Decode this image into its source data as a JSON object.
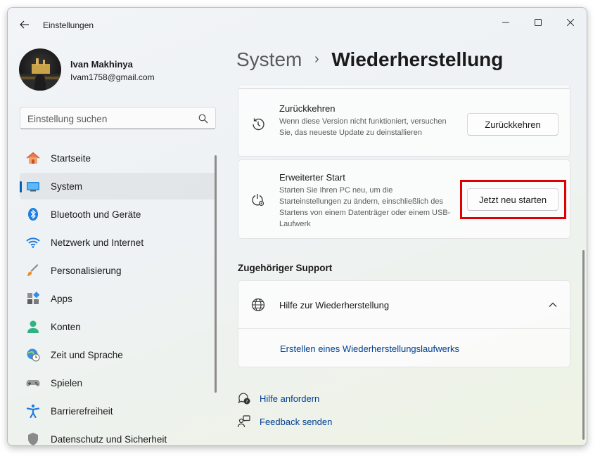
{
  "app": {
    "title": "Einstellungen"
  },
  "window_controls": {
    "minimize": "—",
    "maximize": "☐",
    "close": "✕"
  },
  "user": {
    "name": "Ivan Makhinya",
    "email": "Ivam1758@gmail.com"
  },
  "search": {
    "placeholder": "Einstellung suchen"
  },
  "sidebar": {
    "items": [
      {
        "label": "Startseite",
        "icon": "home-icon",
        "selected": false
      },
      {
        "label": "System",
        "icon": "system-icon",
        "selected": true
      },
      {
        "label": "Bluetooth und Geräte",
        "icon": "bluetooth-icon",
        "selected": false
      },
      {
        "label": "Netzwerk und Internet",
        "icon": "wifi-icon",
        "selected": false
      },
      {
        "label": "Personalisierung",
        "icon": "brush-icon",
        "selected": false
      },
      {
        "label": "Apps",
        "icon": "apps-icon",
        "selected": false
      },
      {
        "label": "Konten",
        "icon": "account-icon",
        "selected": false
      },
      {
        "label": "Zeit und Sprache",
        "icon": "globe-clock-icon",
        "selected": false
      },
      {
        "label": "Spielen",
        "icon": "gamepad-icon",
        "selected": false
      },
      {
        "label": "Barrierefreiheit",
        "icon": "accessibility-icon",
        "selected": false
      },
      {
        "label": "Datenschutz und Sicherheit",
        "icon": "shield-icon",
        "selected": false
      }
    ]
  },
  "breadcrumb": {
    "parent": "System",
    "separator": "›",
    "current": "Wiederherstellung"
  },
  "recovery_options": {
    "zurueckkehren": {
      "title": "Zurückkehren",
      "description": "Wenn diese Version nicht funktioniert, versuchen Sie, das neueste Update zu deinstallieren",
      "button": "Zurückkehren",
      "icon": "history-icon"
    },
    "erweiterter_start": {
      "title": "Erweiterter Start",
      "description": "Starten Sie Ihren PC neu, um die Starteinstellungen zu ändern, einschließlich des Startens von einem Datenträger oder einem USB-Laufwerk",
      "button": "Jetzt neu starten",
      "icon": "power-settings-icon"
    }
  },
  "support": {
    "section_title": "Zugehöriger Support",
    "help_title": "Hilfe zur Wiederherstellung",
    "link": "Erstellen eines Wiederherstellungslaufwerks"
  },
  "footer": {
    "help": "Hilfe anfordern",
    "feedback": "Feedback senden"
  },
  "colors": {
    "accent": "#005fb8",
    "link": "#003e92",
    "highlight": "#e00000"
  }
}
